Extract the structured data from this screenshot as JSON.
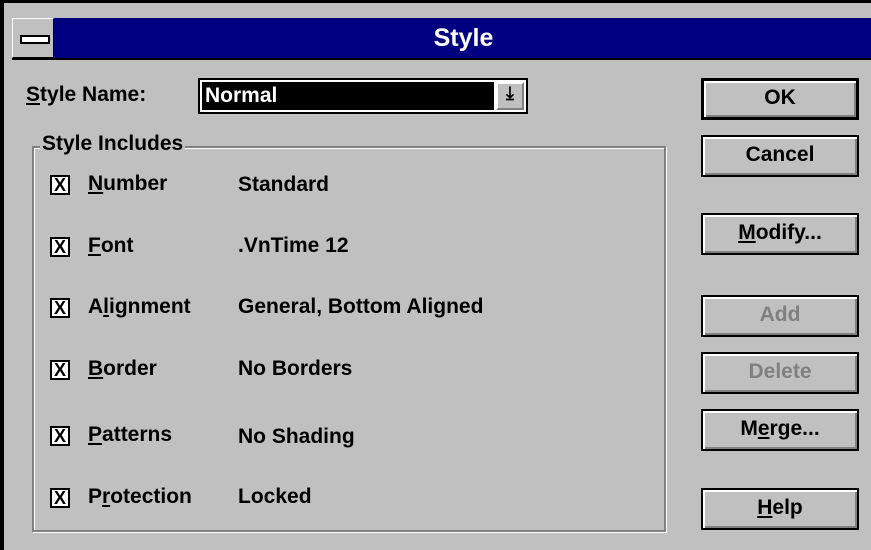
{
  "window": {
    "title": "Style"
  },
  "style_name": {
    "label_u": "S",
    "label_rest": "tyle Name:",
    "value": "Normal"
  },
  "group": {
    "title": "Style Includes",
    "items": [
      {
        "pre": "",
        "u": "N",
        "post": "umber",
        "value": "Standard",
        "checked": "X"
      },
      {
        "pre": "",
        "u": "F",
        "post": "ont",
        "value": ".VnTime 12",
        "checked": "X"
      },
      {
        "pre": "A",
        "u": "l",
        "post": "ignment",
        "value": "General, Bottom Aligned",
        "checked": "X"
      },
      {
        "pre": "",
        "u": "B",
        "post": "order",
        "value": "No Borders",
        "checked": "X"
      },
      {
        "pre": "",
        "u": "P",
        "post": "atterns",
        "value": "No Shading",
        "checked": "X"
      },
      {
        "pre": "P",
        "u": "r",
        "post": "otection",
        "value": "Locked",
        "checked": "X"
      }
    ]
  },
  "buttons": {
    "ok": "OK",
    "cancel": "Cancel",
    "modify": {
      "u": "M",
      "rest": "odify..."
    },
    "add": "Add",
    "delete": "Delete",
    "merge": {
      "pre": "M",
      "u": "e",
      "rest": "rge..."
    },
    "help": {
      "u": "H",
      "rest": "elp"
    }
  },
  "icons": {
    "system_menu": "system-menu-icon",
    "dropdown": "dropdown-arrow-icon",
    "check": "check-mark-icon"
  }
}
